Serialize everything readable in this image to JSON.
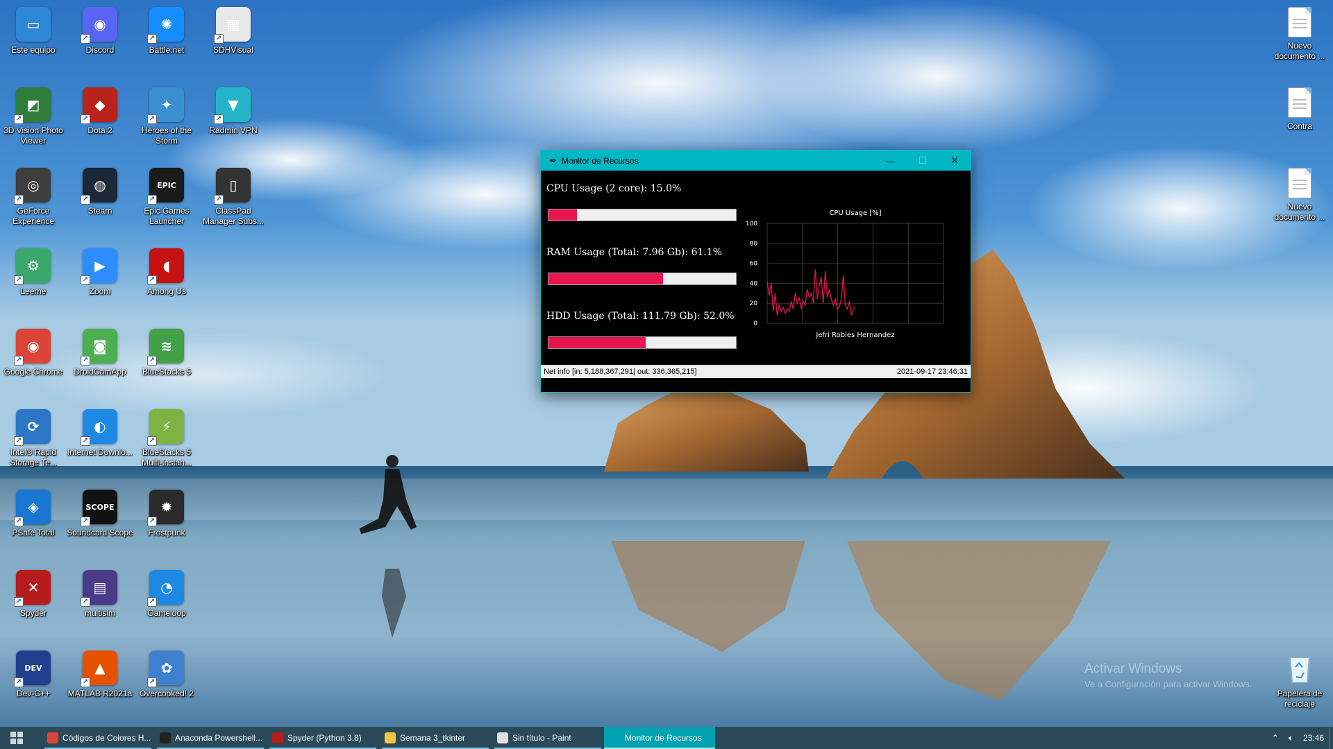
{
  "desktop": {
    "icons": [
      {
        "label": "Este equipo",
        "icon": "computer-icon",
        "color": "#2e86d6",
        "glyph": "▭"
      },
      {
        "label": "Discord",
        "icon": "discord-icon",
        "color": "#5865f2",
        "glyph": "◉"
      },
      {
        "label": "Battle.net",
        "icon": "battlenet-icon",
        "color": "#148eff",
        "glyph": "✺"
      },
      {
        "label": "SDHVisual",
        "icon": "sdhvisual-icon",
        "color": "#e8e8e8",
        "glyph": "▦"
      },
      {
        "label": "3D Vision Photo Viewer",
        "icon": "3d-vision-icon",
        "color": "#2f7d3a",
        "glyph": "◩"
      },
      {
        "label": "Dota 2",
        "icon": "dota2-icon",
        "color": "#b8231c",
        "glyph": "◆"
      },
      {
        "label": "Heroes of the Storm",
        "icon": "heroes-icon",
        "color": "#3a8fd0",
        "glyph": "✦"
      },
      {
        "label": "Radmin VPN",
        "icon": "radmin-vpn-icon",
        "color": "#24b3c8",
        "glyph": "▼"
      },
      {
        "label": "GeForce Experience",
        "icon": "geforce-icon",
        "color": "#3e3e3e",
        "glyph": "◎"
      },
      {
        "label": "Steam",
        "icon": "steam-icon",
        "color": "#1b2838",
        "glyph": "◍"
      },
      {
        "label": "Epic Games Launcher",
        "icon": "epic-games-icon",
        "color": "#1a1a1a",
        "glyph": "EPIC"
      },
      {
        "label": "ClassPad Manager Subs...",
        "icon": "classpad-icon",
        "color": "#333333",
        "glyph": "▯"
      },
      {
        "label": "Leeme",
        "icon": "settings-icon",
        "color": "#3aa86a",
        "glyph": "⚙"
      },
      {
        "label": "Zoom",
        "icon": "zoom-icon",
        "color": "#2d8cff",
        "glyph": "▶"
      },
      {
        "label": "Among Us",
        "icon": "among-us-icon",
        "color": "#c51111",
        "glyph": "◖"
      },
      {
        "label": "Google Chrome",
        "icon": "chrome-icon",
        "color": "#db4437",
        "glyph": "◉"
      },
      {
        "label": "DroidCamApp",
        "icon": "droidcam-icon",
        "color": "#4caf50",
        "glyph": "◙"
      },
      {
        "label": "BlueStacks 5",
        "icon": "bluestacks-icon",
        "color": "#43a047",
        "glyph": "≋"
      },
      {
        "label": "Intel® Rapid Storage Te...",
        "icon": "intel-rst-icon",
        "color": "#2b77c5",
        "glyph": "⟳"
      },
      {
        "label": "Internet Downlo...",
        "icon": "idm-icon",
        "color": "#1e88e5",
        "glyph": "◐"
      },
      {
        "label": "BlueStacks 5 Multi-Instan...",
        "icon": "bluestacks-multi-icon",
        "color": "#7cb342",
        "glyph": "⚡"
      },
      {
        "label": "PSafe Total",
        "icon": "psafe-icon",
        "color": "#1976d2",
        "glyph": "◈"
      },
      {
        "label": "Soundcard Scope",
        "icon": "soundcard-scope-icon",
        "color": "#111111",
        "glyph": "SCOPE"
      },
      {
        "label": "Frostpunk",
        "icon": "frostpunk-icon",
        "color": "#2b2b2b",
        "glyph": "✹"
      },
      {
        "label": "Spyder",
        "icon": "spyder-icon",
        "color": "#b71c1c",
        "glyph": "✕"
      },
      {
        "label": "multisim",
        "icon": "multisim-icon",
        "color": "#4a3a8a",
        "glyph": "▤"
      },
      {
        "label": "Gameloop",
        "icon": "gameloop-icon",
        "color": "#1e88e5",
        "glyph": "◔"
      },
      {
        "label": "Dev-C++",
        "icon": "dev-cpp-icon",
        "color": "#1f3f8f",
        "glyph": "DEV"
      },
      {
        "label": "MATLAB R2021a",
        "icon": "matlab-icon",
        "color": "#e65100",
        "glyph": "▲"
      },
      {
        "label": "Overcooked! 2",
        "icon": "overcooked-icon",
        "color": "#3f7fd0",
        "glyph": "✿"
      }
    ],
    "right_icons": [
      {
        "label": "Nuevo documento ...",
        "icon": "text-document-icon"
      },
      {
        "label": "Contra",
        "icon": "text-document-icon"
      },
      {
        "label": "Nuevo documento ...",
        "icon": "text-document-icon"
      },
      {
        "label": "Papelera de reciclaje",
        "icon": "recycle-bin-icon"
      }
    ]
  },
  "window": {
    "title": "Monitor de Recursos",
    "cpu_label": "CPU Usage (2 core): 15.0%",
    "cpu_percent": 15.0,
    "ram_label": "RAM Usage (Total: 7.96 Gb): 61.1%",
    "ram_percent": 61.1,
    "hdd_label": "HDD Usage (Total: 111.79 Gb): 52.0%",
    "hdd_percent": 52.0,
    "status_left": "Net info [in: 5,188,367,291| out: 336,365,215]",
    "status_right": "2021-09-17 23:46:31",
    "accent": "#00b7c3",
    "bar_color": "#e8164f"
  },
  "chart_data": {
    "type": "line",
    "title": "CPU Usage [%]",
    "xlabel": "Jefri Robles Hernandez",
    "ylabel": "",
    "ylim": [
      0,
      100
    ],
    "yticks": [
      "0",
      "20",
      "40",
      "60",
      "80",
      "100"
    ],
    "xlim": [
      0,
      100
    ],
    "grid": true,
    "line_color": "#d4144a",
    "values": [
      42,
      28,
      40,
      12,
      30,
      8,
      18,
      12,
      16,
      10,
      14,
      12,
      22,
      14,
      30,
      20,
      26,
      14,
      22,
      18,
      34,
      26,
      30,
      20,
      54,
      24,
      38,
      46,
      20,
      52,
      26,
      34,
      24,
      18,
      24,
      14,
      16,
      24,
      48,
      18,
      14,
      22,
      8,
      14,
      16
    ]
  },
  "watermark": {
    "line1": "Activar Windows",
    "line2": "Ve a Configuración para activar Windows."
  },
  "taskbar": {
    "items": [
      {
        "label": "Códigos de Colores H...",
        "icon": "chrome-icon",
        "color": "#db4437"
      },
      {
        "label": "Anaconda Powershell...",
        "icon": "powershell-icon",
        "color": "#222222"
      },
      {
        "label": "Spyder (Python 3.8)",
        "icon": "spyder-icon",
        "color": "#b71c1c"
      },
      {
        "label": "Semana 3_tkinter",
        "icon": "folder-icon",
        "color": "#f5c542"
      },
      {
        "label": "Sin título - Paint",
        "icon": "paint-icon",
        "color": "#e0e0e0"
      },
      {
        "label": "Monitor de Recursos",
        "icon": "feather-icon",
        "color": "#00a2b0"
      }
    ],
    "time": "23:46"
  }
}
